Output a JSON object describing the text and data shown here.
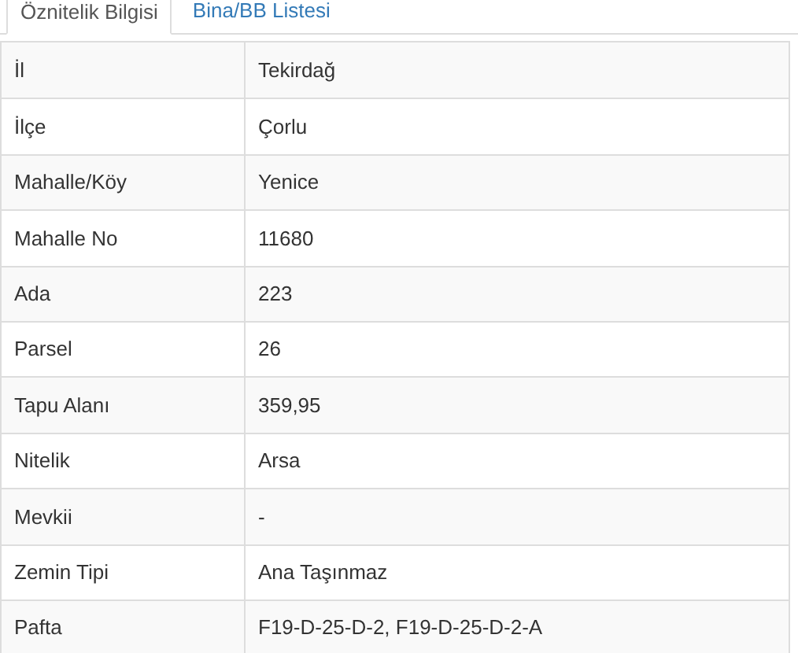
{
  "tabs": [
    {
      "label": "Öznitelik Bilgisi",
      "selected": true
    },
    {
      "label": "Bina/BB Listesi",
      "selected": false
    }
  ],
  "rows": [
    {
      "label": "İl",
      "value": "Tekirdağ"
    },
    {
      "label": "İlçe",
      "value": "Çorlu"
    },
    {
      "label": "Mahalle/Köy",
      "value": "Yenice"
    },
    {
      "label": "Mahalle No",
      "value": "11680"
    },
    {
      "label": "Ada",
      "value": "223"
    },
    {
      "label": "Parsel",
      "value": "26"
    },
    {
      "label": "Tapu Alanı",
      "value": "359,95"
    },
    {
      "label": "Nitelik",
      "value": "Arsa"
    },
    {
      "label": "Mevkii",
      "value": "-"
    },
    {
      "label": "Zemin Tipi",
      "value": "Ana Taşınmaz"
    },
    {
      "label": "Pafta",
      "value": "F19-D-25-D-2, F19-D-25-D-2-A"
    }
  ]
}
